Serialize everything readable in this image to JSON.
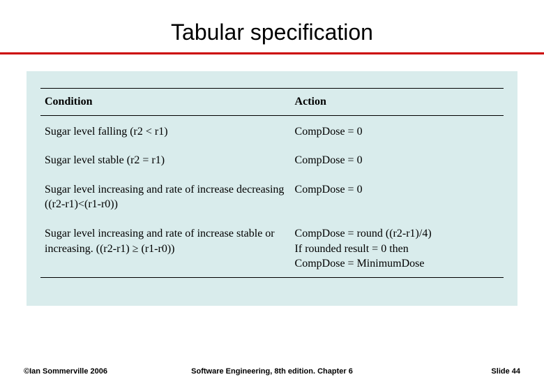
{
  "title": "Tabular specification",
  "headers": {
    "condition": "Condition",
    "action": "Action"
  },
  "rows": [
    {
      "condition": "Sugar level falling (r2 < r1)",
      "action": "CompDose = 0"
    },
    {
      "condition": "Sugar level stable (r2 = r1)",
      "action": "CompDose = 0"
    },
    {
      "condition": "Sugar level increasing and rate of increase decreasing ((r2-r1)<(r1-r0))",
      "action": "CompDose = 0"
    },
    {
      "condition": "Sugar level increasing and rate of increase stable or increasing. ((r2-r1) ≥ (r1-r0))",
      "action": "CompDose = round ((r2-r1)/4)\nIf rounded result = 0 then\nCompDose = MinimumDose"
    }
  ],
  "footer": {
    "left": "©Ian Sommerville 2006",
    "center": "Software Engineering, 8th edition. Chapter 6",
    "right": "Slide  44"
  },
  "chart_data": {
    "type": "table",
    "columns": [
      "Condition",
      "Action"
    ],
    "rows": [
      [
        "Sugar level falling (r2 < r1)",
        "CompDose = 0"
      ],
      [
        "Sugar level stable (r2 = r1)",
        "CompDose = 0"
      ],
      [
        "Sugar level increasing and rate of increase decreasing ((r2-r1)<(r1-r0))",
        "CompDose = 0"
      ],
      [
        "Sugar level increasing and rate of increase stable or increasing. ((r2-r1) ≥ (r1-r0))",
        "CompDose = round ((r2-r1)/4); If rounded result = 0 then CompDose = MinimumDose"
      ]
    ]
  }
}
